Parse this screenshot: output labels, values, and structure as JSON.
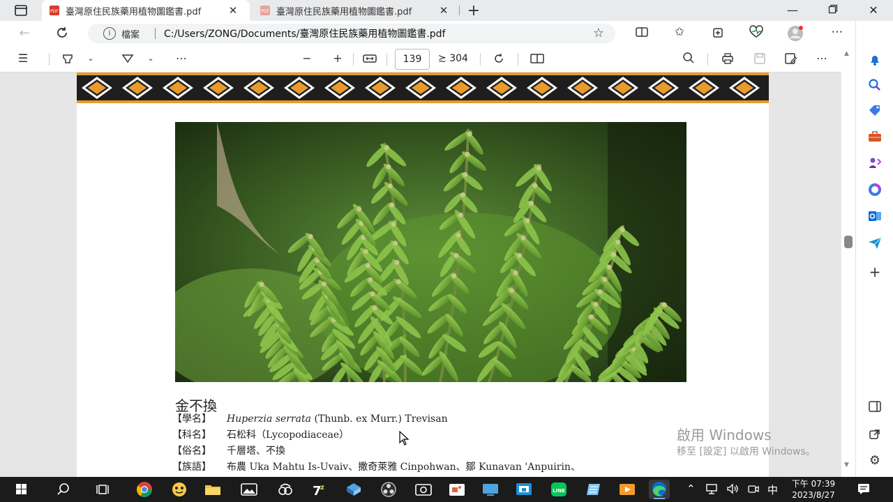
{
  "tabs": [
    {
      "title": "臺灣原住民族藥用植物圖鑑書.pdf",
      "active": true
    },
    {
      "title": "臺灣原住民族藥用植物圖鑑書.pdf",
      "active": false
    }
  ],
  "address": {
    "label": "檔案",
    "url": "C:/Users/ZONG/Documents/臺灣原住民族藥用植物圖鑑書.pdf"
  },
  "pdf_toolbar": {
    "current_page": "139",
    "total_pages": "304"
  },
  "document": {
    "plant_name": "金不換",
    "entries": [
      {
        "label": "【學名】",
        "italic": "Huperzia serrata",
        "text": " (Thunb. ex Murr.) Trevisan"
      },
      {
        "label": "【科名】",
        "italic": "",
        "text": "石松科（Lycopodiaceae）"
      },
      {
        "label": "【俗名】",
        "italic": "",
        "text": "千層塔、不換"
      },
      {
        "label": "【族語】",
        "italic": "",
        "text": "布農 Uka Mahtu Is-Uvaiv、撒奇萊雅 Cinpohwan、鄒 Kunavan 'Anpuirin、"
      }
    ]
  },
  "watermark": {
    "line1": "啟用 Windows",
    "line2": "移至 [設定] 以啟用 Windows。"
  },
  "clock": {
    "time": "下午 07:39",
    "date": "2023/8/27"
  },
  "tray": {
    "ime": "中"
  },
  "colors": {
    "accent_orange": "#e89a2c",
    "banner_dark": "#1e1e1e",
    "taskbar": "#1b1b1b",
    "edge_blue": "#0a6cd8"
  }
}
